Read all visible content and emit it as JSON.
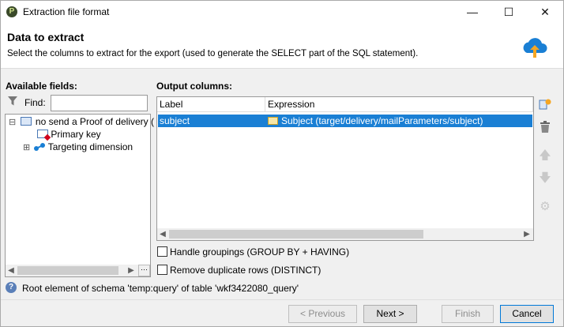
{
  "window": {
    "title": "Extraction file format",
    "minimize": "—",
    "maximize": "☐",
    "close": "✕"
  },
  "header": {
    "title": "Data to extract",
    "subtitle": "Select the columns to extract for the export (used to generate the SELECT part of the SQL statement)."
  },
  "available": {
    "label": "Available fields:",
    "find_label": "Find:",
    "find_value": "",
    "tree": [
      {
        "expander": "⊟",
        "label": "no send a Proof of delivery ("
      },
      {
        "expander": "",
        "label": "Primary key"
      },
      {
        "expander": "⊞",
        "label": "Targeting dimension"
      }
    ]
  },
  "output": {
    "label": "Output columns:",
    "columns": [
      "Label",
      "Expression"
    ],
    "rows": [
      {
        "label": "subject",
        "expression": "Subject (target/delivery/mailParameters/subject)"
      }
    ]
  },
  "options": {
    "groupings": "Handle groupings (GROUP BY + HAVING)",
    "distinct": "Remove duplicate rows (DISTINCT)"
  },
  "status": "Root element of schema 'temp:query' of table 'wkf3422080_query'",
  "buttons": {
    "previous": "< Previous",
    "next": "Next >",
    "finish": "Finish",
    "cancel": "Cancel"
  },
  "colors": {
    "selection": "#1a7fd4",
    "accent": "#0078d7"
  }
}
